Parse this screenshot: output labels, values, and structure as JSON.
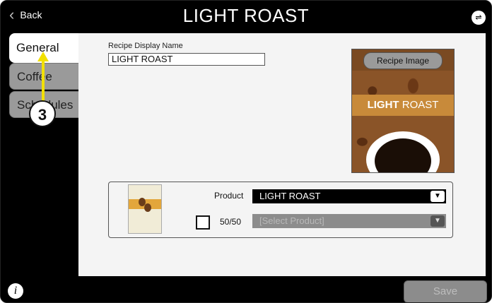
{
  "header": {
    "back_label": "Back",
    "title": "LIGHT ROAST",
    "usb_icon": "usb-icon"
  },
  "tabs": [
    {
      "label": "General",
      "active": true
    },
    {
      "label": "Coffee",
      "active": false
    },
    {
      "label": "Schedules",
      "active": false
    }
  ],
  "form": {
    "recipe_display_name_label": "Recipe Display Name",
    "recipe_display_name_value": "LIGHT ROAST"
  },
  "recipe_image": {
    "button_label": "Recipe Image",
    "banner_bold": "LIGHT",
    "banner_rest": " ROAST"
  },
  "product": {
    "label": "Product",
    "selected": "LIGHT ROAST",
    "half_label": "50/50",
    "half_checked": false,
    "second_placeholder": "[Select Product]"
  },
  "footer": {
    "info_icon": "i",
    "save_label": "Save"
  },
  "annotation": {
    "step": "3",
    "color": "#f2e000"
  }
}
